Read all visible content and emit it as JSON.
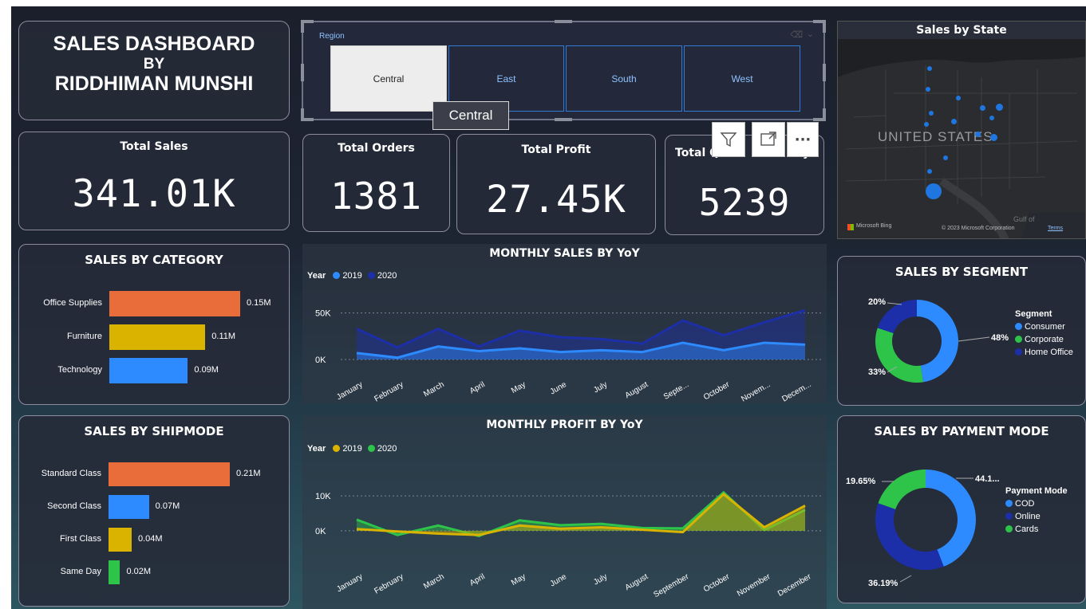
{
  "title": {
    "line1": "SALES DASHBOARD",
    "line2": "BY",
    "line3": "RIDDHIMAN MUNSHI"
  },
  "slicer": {
    "label": "Region",
    "options": [
      "Central",
      "East",
      "South",
      "West"
    ],
    "selected": "Central",
    "tooltip": "Central"
  },
  "visual_header": {
    "icons": [
      "filter-icon",
      "focus-mode-icon",
      "more-options-icon"
    ],
    "more_label": "···"
  },
  "kpis": {
    "total_sales": {
      "label": "Total Sales",
      "value": "341.01K"
    },
    "total_orders": {
      "label": "Total Orders",
      "value": "1381"
    },
    "total_profit": {
      "label": "Total Profit",
      "value": "27.45K"
    },
    "total_quantity": {
      "label": "Total Q",
      "label_tail": "y",
      "value": "5239"
    }
  },
  "map": {
    "title": "Sales by State",
    "country_label": "UNITED STATES",
    "attribution_left": "Microsoft Bing",
    "attribution_right": "© 2023 Microsoft Corporation",
    "terms": "Terms",
    "gulf": "Gulf of"
  },
  "colors": {
    "orange": "#e96d3a",
    "yellow": "#d9b300",
    "blue": "#2d8bff",
    "green": "#2ec44a",
    "navy": "#1d2fa8"
  },
  "chart_data": [
    {
      "id": "sales_by_category",
      "type": "bar",
      "title": "SALES BY CATEGORY",
      "categories": [
        "Office Supplies",
        "Furniture",
        "Technology"
      ],
      "values": [
        0.15,
        0.11,
        0.09
      ],
      "labels": [
        "0.15M",
        "0.11M",
        "0.09M"
      ],
      "colors": [
        "#e96d3a",
        "#d9b300",
        "#2d8bff"
      ]
    },
    {
      "id": "sales_by_shipmode",
      "type": "bar",
      "title": "SALES BY SHIPMODE",
      "categories": [
        "Standard Class",
        "Second Class",
        "First Class",
        "Same Day"
      ],
      "values": [
        0.21,
        0.07,
        0.04,
        0.02
      ],
      "labels": [
        "0.21M",
        "0.07M",
        "0.04M",
        "0.02M"
      ],
      "colors": [
        "#e96d3a",
        "#2d8bff",
        "#d9b300",
        "#2ec44a"
      ]
    },
    {
      "id": "monthly_sales",
      "type": "area",
      "title": "MONTHLY SALES BY YoY",
      "legend_title": "Year",
      "categories": [
        "January",
        "February",
        "March",
        "April",
        "May",
        "June",
        "July",
        "August",
        "Septe...",
        "October",
        "Novem...",
        "Decem..."
      ],
      "series": [
        {
          "name": "2019",
          "color": "#2d8bff",
          "values": [
            7,
            2,
            14,
            9,
            12,
            8,
            10,
            8,
            18,
            10,
            18,
            16
          ]
        },
        {
          "name": "2020",
          "color": "#1d2fa8",
          "values": [
            33,
            13,
            33,
            14,
            31,
            24,
            22,
            17,
            42,
            26,
            40,
            53
          ]
        }
      ],
      "yticks": [
        {
          "v": 0,
          "label": "0K"
        },
        {
          "v": 50,
          "label": "50K"
        }
      ],
      "ylim": [
        0,
        60
      ]
    },
    {
      "id": "monthly_profit",
      "type": "area",
      "title": "MONTHLY PROFIT BY YoY",
      "legend_title": "Year",
      "categories": [
        "January",
        "February",
        "March",
        "April",
        "May",
        "June",
        "July",
        "August",
        "September",
        "October",
        "November",
        "December"
      ],
      "series": [
        {
          "name": "2019",
          "color": "#d9b300",
          "values": [
            0.5,
            -0.2,
            -0.8,
            -1.2,
            1.5,
            0.6,
            1.0,
            0.3,
            -0.4,
            10.5,
            1.0,
            7.2
          ]
        },
        {
          "name": "2020",
          "color": "#2ec44a",
          "values": [
            3.2,
            -1.2,
            1.5,
            -1.5,
            3.0,
            1.6,
            2.0,
            0.8,
            0.7,
            11.0,
            0.2,
            6.0
          ]
        }
      ],
      "yticks": [
        {
          "v": 0,
          "label": "0K"
        },
        {
          "v": 10,
          "label": "10K"
        }
      ],
      "ylim": [
        -3,
        13
      ]
    },
    {
      "id": "sales_by_segment",
      "type": "pie",
      "title": "SALES BY SEGMENT",
      "legend_title": "Segment",
      "labels": [
        "Consumer",
        "Corporate",
        "Home Office"
      ],
      "values": [
        48,
        33,
        20
      ],
      "pct_labels": [
        "48%",
        "33%",
        "20%"
      ],
      "colors": [
        "#2d8bff",
        "#2ec44a",
        "#1d2fa8"
      ]
    },
    {
      "id": "sales_by_payment",
      "type": "pie",
      "title": "SALES BY PAYMENT MODE",
      "legend_title": "Payment Mode",
      "labels": [
        "COD",
        "Online",
        "Cards"
      ],
      "values": [
        44.1,
        36.19,
        19.65
      ],
      "pct_labels": [
        "44.1...",
        "36.19%",
        "19.65%"
      ],
      "colors": [
        "#2d8bff",
        "#1d2fa8",
        "#2ec44a"
      ]
    }
  ]
}
